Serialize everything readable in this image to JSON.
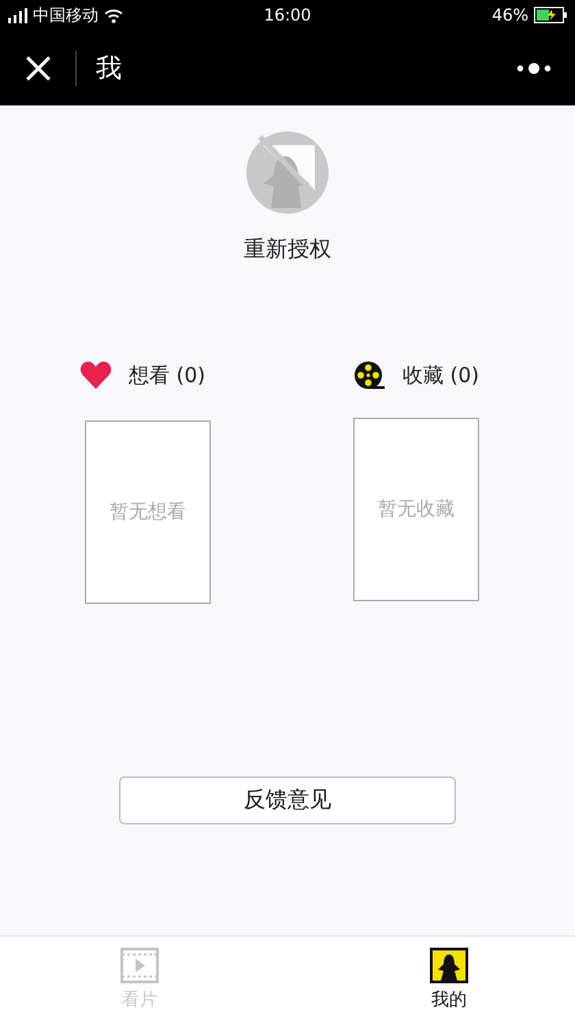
{
  "status_bar": {
    "carrier": "中国移动",
    "time": "16:00",
    "battery": "46%"
  },
  "nav": {
    "title": "我"
  },
  "profile": {
    "label": "重新授权"
  },
  "lists": [
    {
      "kind": "wish",
      "title": "想看 (0)",
      "empty_text": "暂无想看"
    },
    {
      "kind": "collect",
      "title": "收藏 (0)",
      "empty_text": "暂无收藏"
    }
  ],
  "feedback_button": "反馈意见",
  "tabs": [
    {
      "kind": "films",
      "label": "看片",
      "selected": false
    },
    {
      "kind": "me",
      "label": "我的",
      "selected": true
    }
  ]
}
